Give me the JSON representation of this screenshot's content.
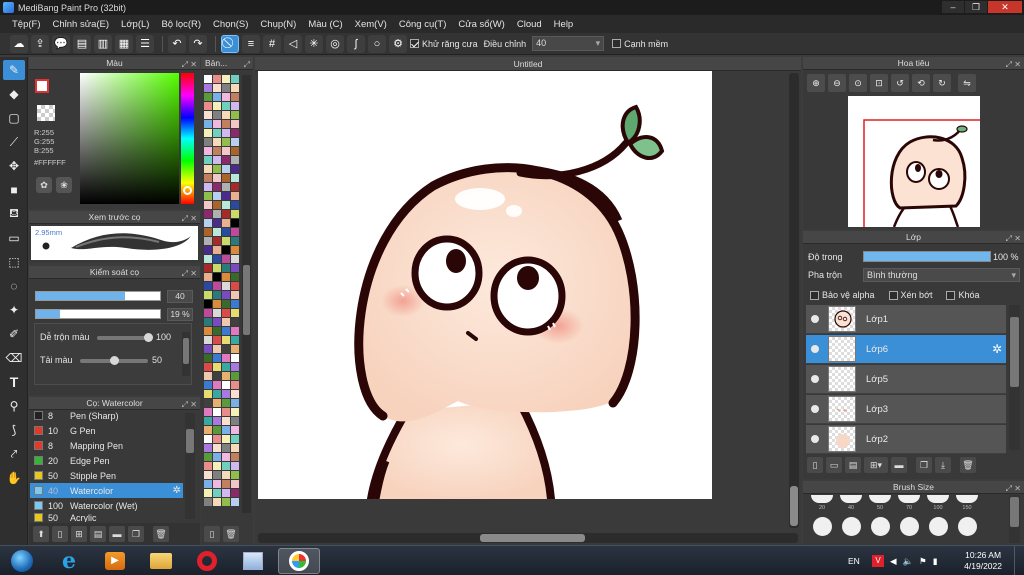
{
  "window": {
    "title": "MediBang Paint Pro (32bit)"
  },
  "menu": [
    "Tệp(F)",
    "Chỉnh sửa(E)",
    "Lớp(L)",
    "Bộ lọc(R)",
    "Chọn(S)",
    "Chụp(N)",
    "Màu (C)",
    "Xem(V)",
    "Công cụ(T)",
    "Cửa sổ(W)",
    "Cloud",
    "Help"
  ],
  "toolbar": {
    "antialias_label": "Khử răng cưa",
    "correction_label": "Điều chỉnh",
    "correction_value": "40",
    "edge_label": "Cạnh mềm"
  },
  "colors": {
    "accent": "#3a8fd6",
    "panel": "#393939",
    "bg": "#3c3c3c"
  },
  "color_panel": {
    "title": "Màu",
    "r": "R:255",
    "g": "G:255",
    "b": "B:255",
    "hex": "#FFFFFF"
  },
  "palette_panel": {
    "title": "Bản..."
  },
  "brush_preview": {
    "title": "Xem trước cọ",
    "size": "2.95mm"
  },
  "brush_control": {
    "title": "Kiểm soát cọ",
    "size_value": "40",
    "opacity_value": "19 %",
    "size_pct": 0.72,
    "opacity_pct": 0.19,
    "blend_label": "Dễ trộn màu",
    "blend_value": "100",
    "load_label": "Tải màu",
    "load_value": "50"
  },
  "brush_list": {
    "title": "Cọ: Watercolor",
    "items": [
      {
        "size": "8",
        "name": "Pen (Sharp)",
        "color": "#222222"
      },
      {
        "size": "10",
        "name": "G Pen",
        "color": "#e23a2a"
      },
      {
        "size": "8",
        "name": "Mapping Pen",
        "color": "#e23a2a"
      },
      {
        "size": "20",
        "name": "Edge Pen",
        "color": "#36b436"
      },
      {
        "size": "50",
        "name": "Stipple Pen",
        "color": "#e8c81e"
      },
      {
        "size": "40",
        "name": "Watercolor",
        "color": "#7cc8ee"
      },
      {
        "size": "100",
        "name": "Watercolor (Wet)",
        "color": "#7cc8ee"
      },
      {
        "size": "50",
        "name": "Acrylic",
        "color": "#e8c81e"
      }
    ]
  },
  "canvas": {
    "title": "Untitled"
  },
  "navigator": {
    "title": "Hoa tiêu"
  },
  "layer_panel": {
    "title": "Lớp",
    "opacity_label": "Độ trong",
    "opacity_value": "100 %",
    "blend_label": "Pha trộn",
    "blend_value": "Bình thường",
    "protect_alpha": "Bảo vệ alpha",
    "clipping": "Xén bớt",
    "lock": "Khóa",
    "layers": [
      "Lớp1",
      "Lớp6",
      "Lớp5",
      "Lớp3",
      "Lớp2"
    ]
  },
  "brush_size_panel": {
    "title": "Brush Size",
    "sizes": [
      "20",
      "40",
      "50",
      "70",
      "100",
      "150"
    ]
  },
  "taskbar": {
    "lang": "EN",
    "time": "10:26 AM",
    "date": "4/19/2022"
  }
}
